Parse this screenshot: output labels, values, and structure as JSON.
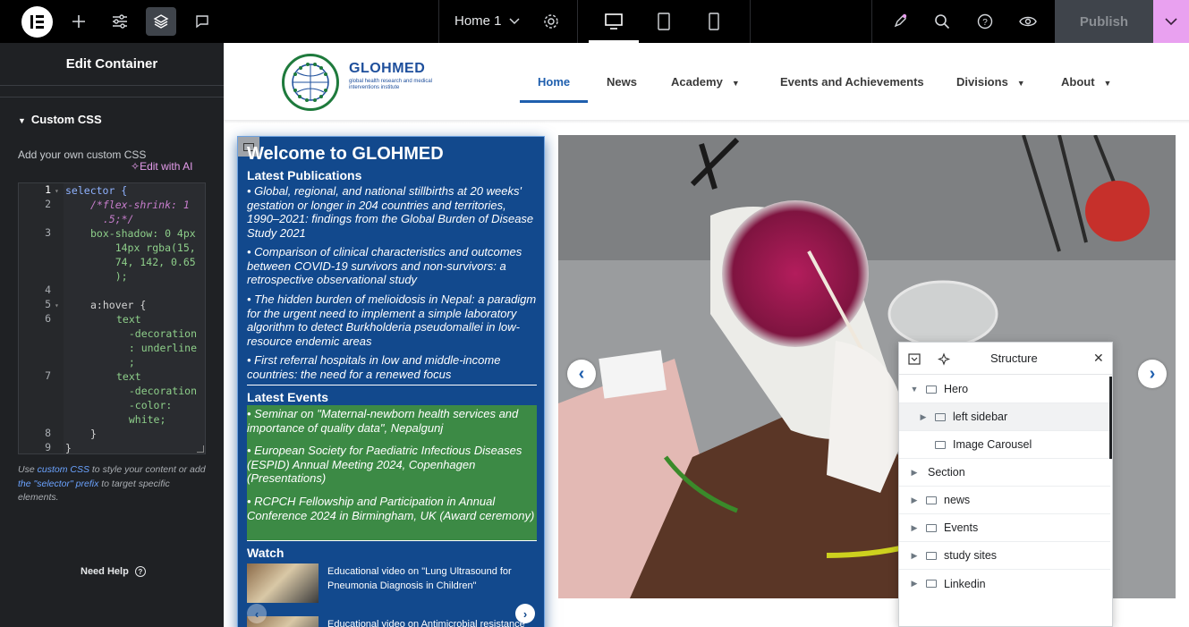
{
  "topbar": {
    "document_title": "Home 1",
    "publish_label": "Publish",
    "icons": [
      "elementor-logo-icon",
      "add-icon",
      "sliders-icon",
      "layers-icon",
      "comment-icon",
      "chevron-down-icon",
      "gear-icon",
      "desktop-icon",
      "tablet-icon",
      "mobile-icon",
      "rocket-icon",
      "search-icon",
      "help-icon",
      "eye-icon",
      "chevron-down-icon"
    ]
  },
  "panel": {
    "title": "Edit Container",
    "section_title": "Custom CSS",
    "description": "Add your own custom CSS",
    "edit_with_ai": "Edit with AI",
    "code_lines": [
      {
        "n": "1",
        "text": "selector {"
      },
      {
        "n": "2",
        "text": "/*flex-shrink: 1\n  .5;*/"
      },
      {
        "n": "3",
        "text": "box-shadow: 0 4px\n    14px rgba(15,\n    74, 142, 0.65\n    );"
      },
      {
        "n": "4",
        "text": ""
      },
      {
        "n": "5",
        "text": "a:hover {"
      },
      {
        "n": "6",
        "text": "text\n  -decoration\n  : underline\n  ;"
      },
      {
        "n": "7",
        "text": "text\n  -decoration\n  -color:\n  white;"
      },
      {
        "n": "8",
        "text": "}"
      },
      {
        "n": "9",
        "text": "}"
      }
    ],
    "help_prefix": "Use",
    "help_link1": "custom CSS",
    "help_mid": "to style your content or add",
    "help_link2": "the \"selector\" prefix",
    "help_suffix": "to target specific elements.",
    "need_help": "Need Help"
  },
  "site": {
    "logo_name": "GLOHMED",
    "logo_sub": "global health research and medical interventions institute",
    "nav": [
      "Home",
      "News",
      "Academy",
      "Events and Achievements",
      "Divisions",
      "About"
    ],
    "active_nav": "Home",
    "sidebar": {
      "title": "Welcome to GLOHMED",
      "publications_heading": "Latest Publications",
      "publications": [
        "• Global, regional, and national stillbirths at 20 weeks' gestation or longer in 204 countries and territories, 1990–2021: findings from the Global Burden of Disease Study 2021",
        "• Comparison of clinical characteristics and outcomes between COVID-19 survivors and non-survivors: a retrospective observational study",
        "• The hidden burden of melioidosis in Nepal: a paradigm for the urgent need to implement a simple laboratory algorithm to detect  Burkholderia pseudomallei in low-resource endemic areas",
        "• First referral hospitals in low and middle-income countries: the need for a renewed focus"
      ],
      "events_heading": "Latest Events",
      "events": [
        "• Seminar on \"Maternal-newborn health services and importance of quality data\", Nepalgunj",
        "• European Society for Paediatric Infectious Diseases (ESPID) Annual Meeting 2024, Copenhagen (Presentations)",
        "• RCPCH Fellowship and Participation in Annual Conference 2024 in Birmingham, UK (Award ceremony)"
      ],
      "watch_heading": "Watch",
      "videos": [
        "Educational video on \"Lung Ultrasound for Pneumonia Diagnosis in Children\"",
        "Educational video on Antimicrobial resistance"
      ]
    }
  },
  "structure": {
    "title": "Structure",
    "items": [
      {
        "label": "Hero",
        "expanded": true
      },
      {
        "label": "left sidebar",
        "selected": true
      },
      {
        "label": "Image Carousel"
      },
      {
        "label": "Section"
      },
      {
        "label": "news"
      },
      {
        "label": "Events"
      },
      {
        "label": "study sites"
      },
      {
        "label": "Linkedin"
      }
    ]
  }
}
